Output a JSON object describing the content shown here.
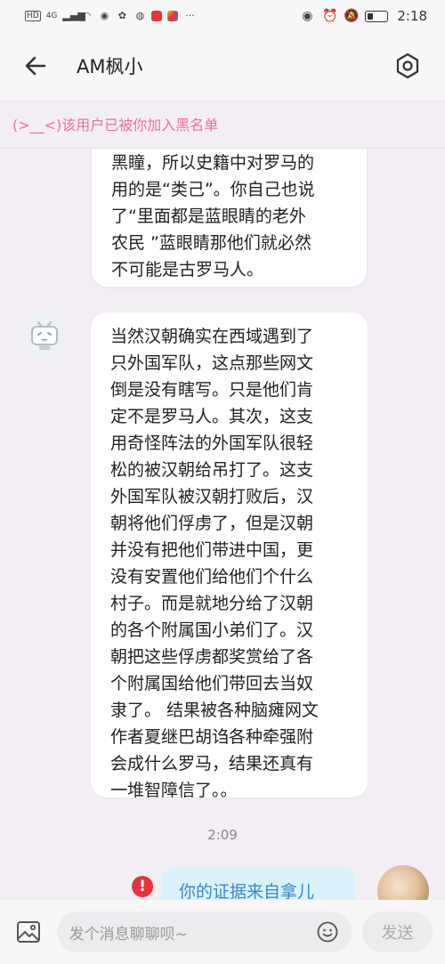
{
  "status_bar": {
    "left_badges": [
      "HD",
      "4G"
    ],
    "time": "2:18",
    "battery_level": 0.25
  },
  "header": {
    "title": "AM枫小",
    "back_icon": "arrow-left-icon",
    "settings_icon": "hexagon-settings-icon"
  },
  "notice": {
    "text": "(>__<)该用户已被你加入黑名单"
  },
  "messages": [
    {
      "side": "left",
      "lines": [
        "黑瞳，所以史籍中对罗马的",
        "用的是“类己”。你自己也说",
        "了“里面都是蓝眼睛的老外",
        "农民 ”蓝眼睛那他们就必然",
        "不可能是古罗马人。"
      ]
    },
    {
      "side": "left",
      "lines": [
        "当然汉朝确实在西域遇到了",
        "只外国军队，这点那些网文",
        "倒是没有瞎写。只是他们肯",
        "定不是罗马人。其次，这支",
        "用奇怪阵法的外国军队很轻",
        "松的被汉朝给吊打了。这支",
        "外国军队被汉朝打败后，汉",
        "朝将他们俘虏了，但是汉朝",
        "并没有把他们带进中国，更",
        "没有安置他们给他们个什么",
        "村子。而是就地分给了汉朝",
        "的各个附属国小弟们了。汉",
        "朝把这些俘虏都奖赏给了各",
        "个附属国给他们带回去当奴",
        "隶了。 结果被各种脑瘫网文",
        "作者夏继巴胡诌各种牵强附",
        "会成什么罗马，结果还真有",
        "一堆智障信了。。"
      ]
    },
    {
      "side": "right",
      "text": "你的证据来自拿儿",
      "failed_mark": "!"
    }
  ],
  "timestamp": "2:09",
  "input": {
    "placeholder": "发个消息聊聊呗~",
    "send_label": "发送"
  },
  "colors": {
    "notice_pink": "#ee6e99",
    "my_bubble": "#d9f1fb",
    "my_text": "#3a88c6",
    "error_red": "#e8323c"
  }
}
